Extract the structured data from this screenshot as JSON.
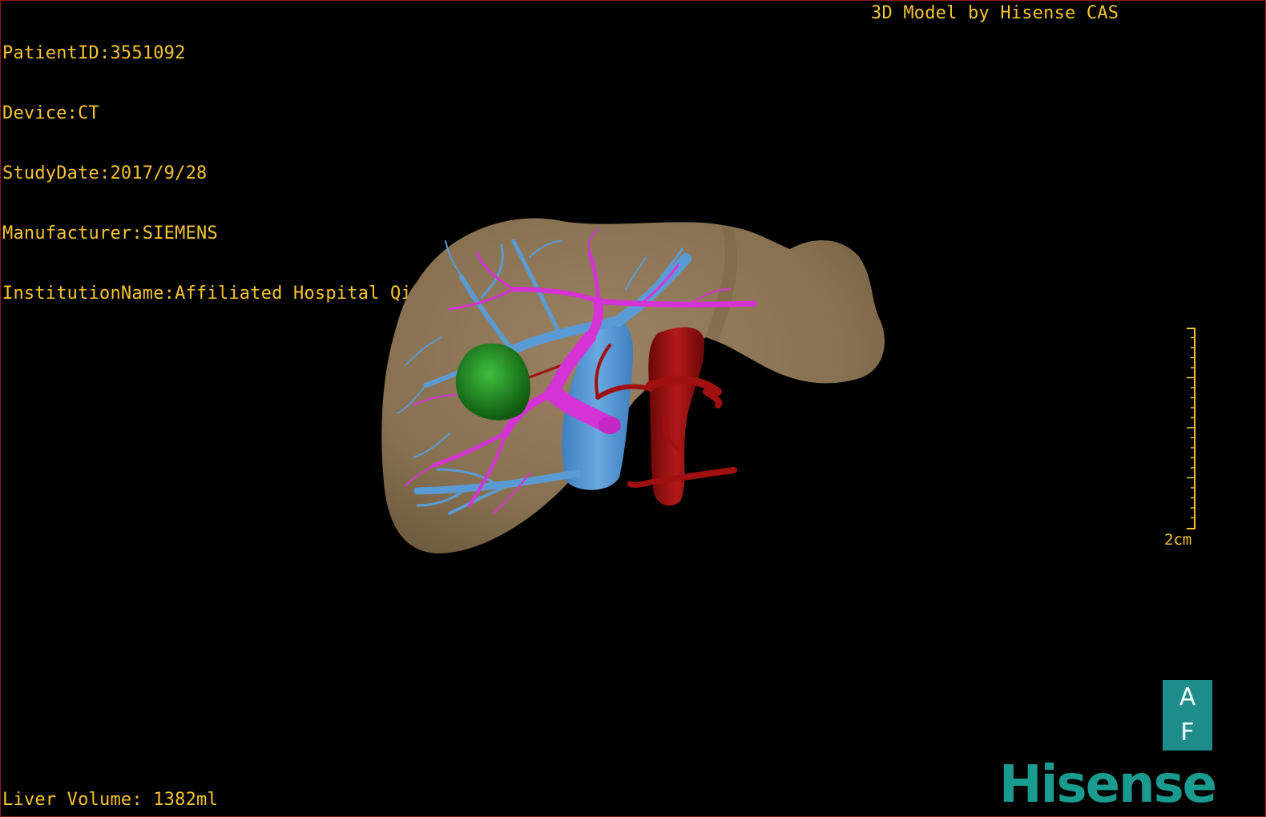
{
  "info": {
    "patient_id": "PatientID:3551092",
    "device": "Device:CT",
    "study_date": "StudyDate:2017/9/28",
    "manufacturer": "Manufacturer:SIEMENS",
    "institution": "InstitutionName:Affiliated Hospital Qingdao University-C"
  },
  "credit": "3D Model by Hisense CAS",
  "liver_volume": "Liver Volume: 1382ml",
  "scale": {
    "label": "2cm"
  },
  "orientation": {
    "top": "A",
    "bottom": "F"
  },
  "brand": "Hisense",
  "colors": {
    "overlay_text": "#f4c430",
    "liver": "#8b7355",
    "portal_vein": "#d633d6",
    "hepatic_vein": "#5b9bd5",
    "artery": "#a01010",
    "tumor": "#1f8a1f",
    "brand": "#1a9b8f",
    "orientation_box": "#1e8c8a"
  }
}
